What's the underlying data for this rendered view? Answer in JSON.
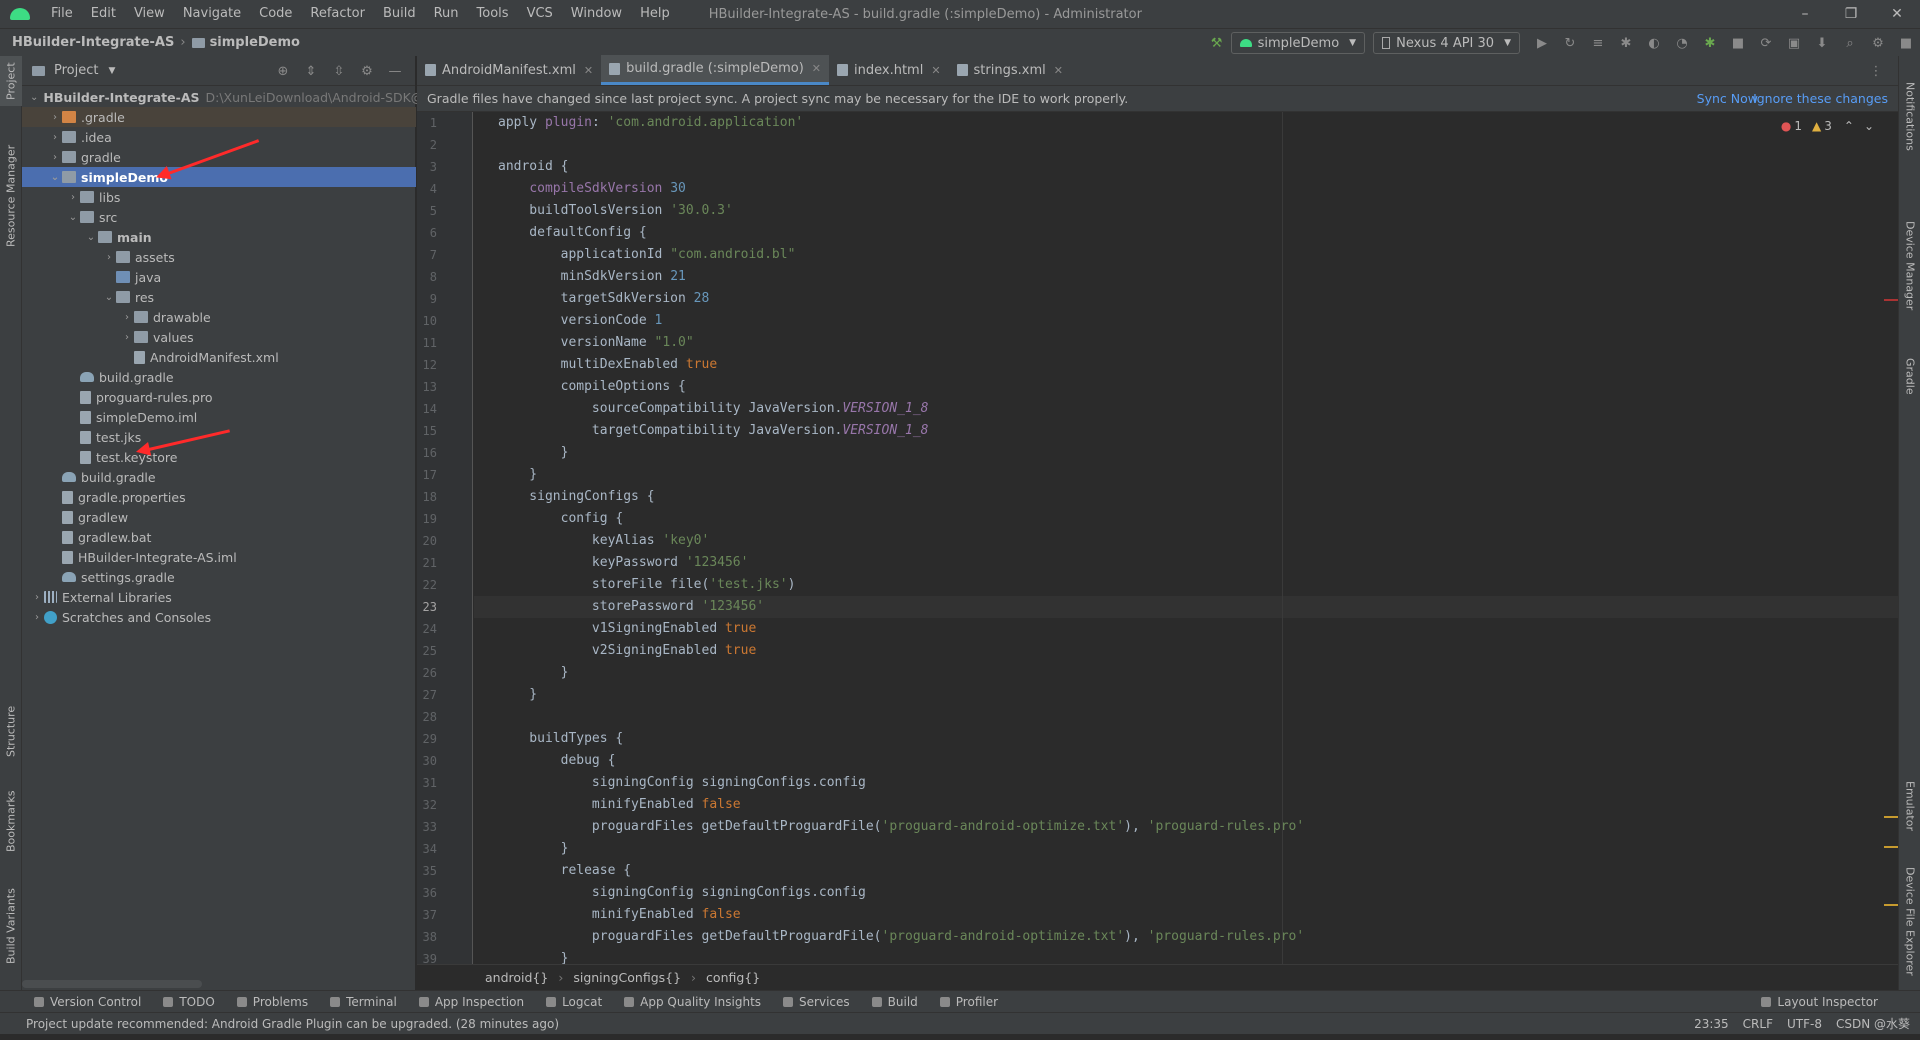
{
  "menubar": {
    "items": [
      "File",
      "Edit",
      "View",
      "Navigate",
      "Code",
      "Refactor",
      "Build",
      "Run",
      "Tools",
      "VCS",
      "Window",
      "Help"
    ],
    "title": "HBuilder-Integrate-AS - build.gradle (:simpleDemo) - Administrator",
    "minimize": "–",
    "restore": "❐",
    "close": "✕"
  },
  "navbar": {
    "project": "HBuilder-Integrate-AS",
    "module": "simpleDemo",
    "run_config": "simpleDemo",
    "device": "Nexus 4 API 30"
  },
  "project_panel": {
    "header": "Project",
    "tree": [
      {
        "label": "HBuilder-Integrate-AS",
        "hint": "D:\\XunLeiDownload\\Android-SDK@",
        "depth": 0,
        "arrow": "down",
        "icon": "folder",
        "bold": true
      },
      {
        "label": ".gradle",
        "depth": 1,
        "arrow": "right",
        "icon": "folder-orange",
        "gradle_dir": true
      },
      {
        "label": ".idea",
        "depth": 1,
        "arrow": "right",
        "icon": "folder"
      },
      {
        "label": "gradle",
        "depth": 1,
        "arrow": "right",
        "icon": "folder"
      },
      {
        "label": "simpleDemo",
        "depth": 1,
        "arrow": "down",
        "icon": "folder",
        "selected": true
      },
      {
        "label": "libs",
        "depth": 2,
        "arrow": "right",
        "icon": "folder"
      },
      {
        "label": "src",
        "depth": 2,
        "arrow": "down",
        "icon": "folder"
      },
      {
        "label": "main",
        "depth": 3,
        "arrow": "down",
        "icon": "folder",
        "bold": true
      },
      {
        "label": "assets",
        "depth": 4,
        "arrow": "right",
        "icon": "folder"
      },
      {
        "label": "java",
        "depth": 4,
        "arrow": "",
        "icon": "folder-blue"
      },
      {
        "label": "res",
        "depth": 4,
        "arrow": "down",
        "icon": "folder"
      },
      {
        "label": "drawable",
        "depth": 5,
        "arrow": "right",
        "icon": "folder"
      },
      {
        "label": "values",
        "depth": 5,
        "arrow": "right",
        "icon": "folder"
      },
      {
        "label": "AndroidManifest.xml",
        "depth": 5,
        "arrow": "",
        "icon": "file"
      },
      {
        "label": "build.gradle",
        "depth": 2,
        "arrow": "",
        "icon": "gradle"
      },
      {
        "label": "proguard-rules.pro",
        "depth": 2,
        "arrow": "",
        "icon": "file"
      },
      {
        "label": "simpleDemo.iml",
        "depth": 2,
        "arrow": "",
        "icon": "file"
      },
      {
        "label": "test.jks",
        "depth": 2,
        "arrow": "",
        "icon": "file"
      },
      {
        "label": "test.keystore",
        "depth": 2,
        "arrow": "",
        "icon": "file"
      },
      {
        "label": "build.gradle",
        "depth": 1,
        "arrow": "",
        "icon": "gradle"
      },
      {
        "label": "gradle.properties",
        "depth": 1,
        "arrow": "",
        "icon": "file"
      },
      {
        "label": "gradlew",
        "depth": 1,
        "arrow": "",
        "icon": "file"
      },
      {
        "label": "gradlew.bat",
        "depth": 1,
        "arrow": "",
        "icon": "file"
      },
      {
        "label": "HBuilder-Integrate-AS.iml",
        "depth": 1,
        "arrow": "",
        "icon": "file"
      },
      {
        "label": "settings.gradle",
        "depth": 1,
        "arrow": "",
        "icon": "gradle"
      },
      {
        "label": "External Libraries",
        "depth": 0,
        "arrow": "right",
        "icon": "lib"
      },
      {
        "label": "Scratches and Consoles",
        "depth": 0,
        "arrow": "right",
        "icon": "scratch"
      }
    ]
  },
  "left_stripe": [
    "Project",
    "Resource Manager",
    "Structure",
    "Bookmarks",
    "Build Variants"
  ],
  "right_stripe": [
    "Notifications",
    "Device Manager",
    "Gradle",
    "Emulator",
    "Device File Explorer"
  ],
  "editor": {
    "tabs": [
      {
        "label": "AndroidManifest.xml",
        "active": false
      },
      {
        "label": "build.gradle (:simpleDemo)",
        "active": true
      },
      {
        "label": "index.html",
        "active": false
      },
      {
        "label": "strings.xml",
        "active": false
      }
    ],
    "banner": {
      "message": "Gradle files have changed since last project sync. A project sync may be necessary for the IDE to work properly.",
      "sync_now": "Sync Now",
      "ignore": "Ignore these changes"
    },
    "inspections": {
      "errors": "1",
      "warnings": "3"
    },
    "current_line": 23,
    "lines": [
      "apply plugin: 'com.android.application'",
      "",
      "android {",
      "    compileSdkVersion 30",
      "    buildToolsVersion '30.0.3'",
      "    defaultConfig {",
      "        applicationId \"com.android.bl\"",
      "        minSdkVersion 21",
      "        targetSdkVersion 28",
      "        versionCode 1",
      "        versionName \"1.0\"",
      "        multiDexEnabled true",
      "        compileOptions {",
      "            sourceCompatibility JavaVersion.VERSION_1_8",
      "            targetCompatibility JavaVersion.VERSION_1_8",
      "        }",
      "    }",
      "    signingConfigs {",
      "        config {",
      "            keyAlias 'key0'",
      "            keyPassword '123456'",
      "            storeFile file('test.jks')",
      "            storePassword '123456'",
      "            v1SigningEnabled true",
      "            v2SigningEnabled true",
      "        }",
      "    }",
      "",
      "    buildTypes {",
      "        debug {",
      "            signingConfig signingConfigs.config",
      "            minifyEnabled false",
      "            proguardFiles getDefaultProguardFile('proguard-android-optimize.txt'), 'proguard-rules.pro'",
      "        }",
      "        release {",
      "            signingConfig signingConfigs.config",
      "            minifyEnabled false",
      "            proguardFiles getDefaultProguardFile('proguard-android-optimize.txt'), 'proguard-rules.pro'",
      "        }"
    ],
    "breadcrumbs": [
      "android{}",
      "signingConfigs{}",
      "config{}"
    ]
  },
  "bottom_tools": [
    "Version Control",
    "TODO",
    "Problems",
    "Terminal",
    "App Inspection",
    "Logcat",
    "App Quality Insights",
    "Services",
    "Build",
    "Profiler"
  ],
  "layout_inspector": "Layout Inspector",
  "status_bar": {
    "message": "Project update recommended: Android Gradle Plugin can be upgraded. (28 minutes ago)",
    "position": "23:35",
    "line_sep": "CRLF",
    "encoding": "UTF-8",
    "watermark": "CSDN @水葵"
  },
  "colors": {
    "accent": "#4b6eaf",
    "keyword": "#cc7832",
    "string": "#6a8759",
    "number": "#6897bb",
    "link": "#589df6",
    "annotation_arrow": "#ff2a2a"
  }
}
